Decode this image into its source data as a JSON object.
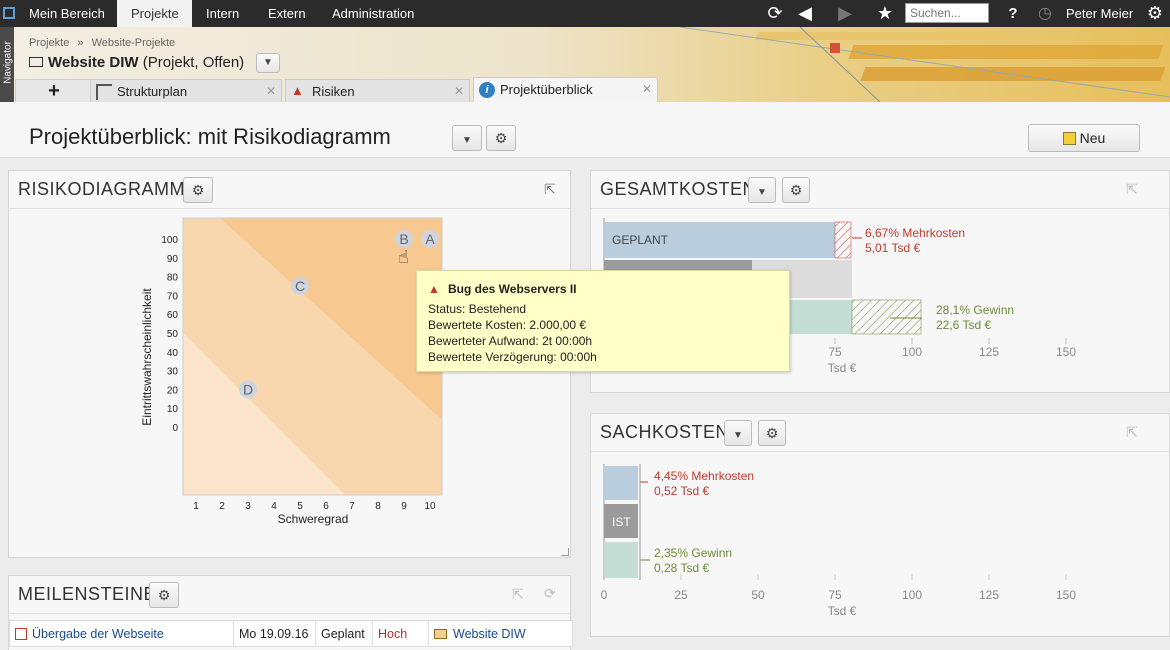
{
  "topnav": {
    "items": [
      "Mein Bereich",
      "Projekte",
      "Intern",
      "Extern",
      "Administration"
    ],
    "active": "Projekte",
    "search_placeholder": "Suchen...",
    "help": "?",
    "user": "Peter Meier"
  },
  "navigator_label": "Navigator",
  "breadcrumb": [
    "Projekte",
    "Website-Projekte"
  ],
  "breadcrumb_sep": "»",
  "project": {
    "name": "Website DIW",
    "meta": "(Projekt, Offen)"
  },
  "tabs": [
    {
      "label": "Strukturplan",
      "icon": "structure-icon"
    },
    {
      "label": "Risiken",
      "icon": "risk-warning-icon"
    },
    {
      "label": "Projektüberblick",
      "icon": "info-icon"
    }
  ],
  "tab_add": "+",
  "tab_close": "✕",
  "page_title": "Projektüberblick: mit Risikodiagramm",
  "new_button": "Neu",
  "risk_panel": {
    "title": "RISIKODIAGRAMM",
    "xlabel": "Schweregrad",
    "ylabel": "Eintrittswahrscheinlichkeit",
    "xticks": [
      "1",
      "2",
      "3",
      "4",
      "5",
      "6",
      "7",
      "8",
      "9",
      "10"
    ],
    "yticks": [
      "100",
      "90",
      "80",
      "70",
      "60",
      "50",
      "40",
      "30",
      "20",
      "10",
      "0"
    ],
    "points": [
      {
        "label": "A",
        "x": 10,
        "y": 100
      },
      {
        "label": "B",
        "x": 9,
        "y": 100
      },
      {
        "label": "C",
        "x": 5,
        "y": 75
      },
      {
        "label": "D",
        "x": 3,
        "y": 20
      }
    ]
  },
  "tooltip": {
    "title": "Bug des Webservers II",
    "lines": [
      "Status: Bestehend",
      "Bewertete Kosten: 2.000,00 €",
      "Bewerteter Aufwand: 2t 00:00h",
      "Bewertete Verzögerung: 00:00h"
    ]
  },
  "gesamtkosten": {
    "title": "GESAMTKOSTEN",
    "bar_label": "GEPLANT",
    "over_pct": "6,67% Mehrkosten",
    "over_val": "5,01 Tsd €",
    "gain_pct": "28,1% Gewinn",
    "gain_val": "22,6 Tsd €",
    "xticks": [
      "75",
      "100",
      "125",
      "150"
    ],
    "unit": "Tsd €"
  },
  "sachkosten": {
    "title": "SACHKOSTEN",
    "bar_label": "IST",
    "over_pct": "4,45% Mehrkosten",
    "over_val": "0,52 Tsd €",
    "gain_pct": "2,35% Gewinn",
    "gain_val": "0,28 Tsd €",
    "xticks": [
      "0",
      "25",
      "50",
      "75",
      "100",
      "125",
      "150"
    ],
    "unit": "Tsd €"
  },
  "meilensteine": {
    "title": "MEILENSTEINE",
    "rows": [
      {
        "name": "Übergabe der Webseite",
        "date": "Mo 19.09.16",
        "status": "Geplant",
        "prio": "Hoch",
        "project": "Website DIW"
      }
    ]
  },
  "colors": {
    "accent": "#c0392b",
    "gain": "#6f8a3a",
    "planned": "#b9cddc",
    "ist": "#9b9b9b",
    "green": "#c4ddd5"
  }
}
